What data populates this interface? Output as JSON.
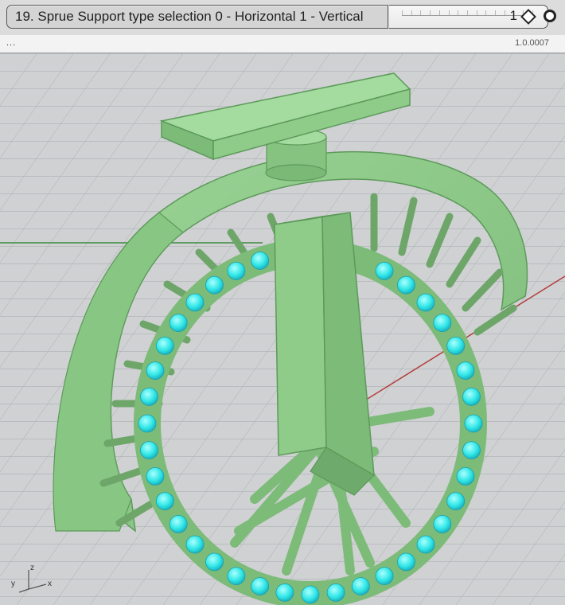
{
  "slider": {
    "label": "19. Sprue Support type selection 0 - Horizontal 1 - Vertical",
    "value": "1"
  },
  "status": {
    "dots": "...",
    "version": "1.0.0007"
  },
  "viewport": {
    "axes": {
      "y": "y",
      "z": "z",
      "x": "x"
    },
    "colors": {
      "background": "#cfd1d3",
      "grid": "#a9acaf",
      "model": "#8fcc8a",
      "model_shadow": "#6eaa6b",
      "supports": "#2fe6e6",
      "x_axis": "#b33a3a",
      "y_axis": "#3d8a3d"
    }
  }
}
